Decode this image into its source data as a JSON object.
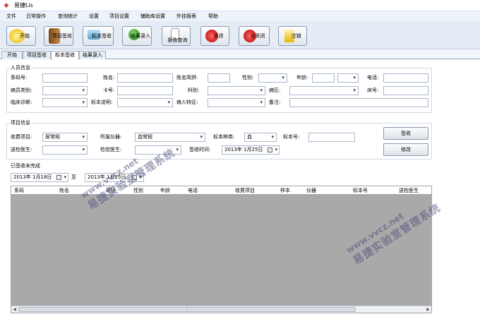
{
  "window": {
    "title": "易捷Lis"
  },
  "menu": [
    "文件",
    "日常操作",
    "查询统计",
    "设置",
    "项目设置",
    "辅助库设置",
    "外挂报表",
    "帮助"
  ],
  "toolbar": [
    {
      "label": "开始",
      "icon": "start-icon"
    },
    {
      "label": "项目签收",
      "icon": "book-icon"
    },
    {
      "label": "标本签收",
      "icon": "screen-icon"
    },
    {
      "label": "结果录入",
      "icon": "people-icon"
    },
    {
      "label": "报告查询",
      "icon": "document-icon"
    },
    {
      "label": "关闭",
      "icon": "close-icon"
    },
    {
      "label": "全关闭",
      "icon": "close-all-icon"
    },
    {
      "label": "注销",
      "icon": "logout-icon"
    }
  ],
  "tabs": [
    "开始",
    "项目签收",
    "标本签收",
    "结果录入"
  ],
  "active_tab": "标本签收",
  "person_info": {
    "title": "人员信息",
    "barcode_label": "条码号:",
    "name_label": "姓名:",
    "name_initials_label": "姓名简拼:",
    "gender_label": "性别:",
    "age_label": "年龄:",
    "phone_label": "电话:",
    "patient_type_label": "病员类别:",
    "card_no_label": "卡号:",
    "department_label": "科别:",
    "ward_label": "病区:",
    "bed_label": "床号:",
    "diagnosis_label": "临床诊断:",
    "specimen_note_label": "标本说明:",
    "patient_feature_label": "病人特征:",
    "remark_label": "备注:"
  },
  "item_info": {
    "title": "项目信息",
    "charge_item_label": "收费项目:",
    "charge_item_value": "尿常规",
    "instrument_label": "所属仪器:",
    "instrument_value": "血常规",
    "specimen_type_label": "标本种类:",
    "specimen_type_value": "血",
    "specimen_no_label": "标本号:",
    "sender_label": "送检医生:",
    "checker_label": "检验医生:",
    "receive_time_label": "签收时间:",
    "receive_time_value": "2013年 1月25日",
    "sign_button": "签收",
    "edit_button": "修改"
  },
  "pending": {
    "title": "已签收未完成",
    "date_from": "2013年 1月18日",
    "to_label": "至",
    "date_to": "2013年 1月25日"
  },
  "table_columns": [
    "条码",
    "姓名",
    "简拼",
    "性别",
    "年龄",
    "电话",
    "收费项目",
    "样本",
    "仪器",
    "标本号",
    "送检医生"
  ],
  "watermark": {
    "url": "www.vvcz.net",
    "name": "易捷实验室管理系统"
  }
}
